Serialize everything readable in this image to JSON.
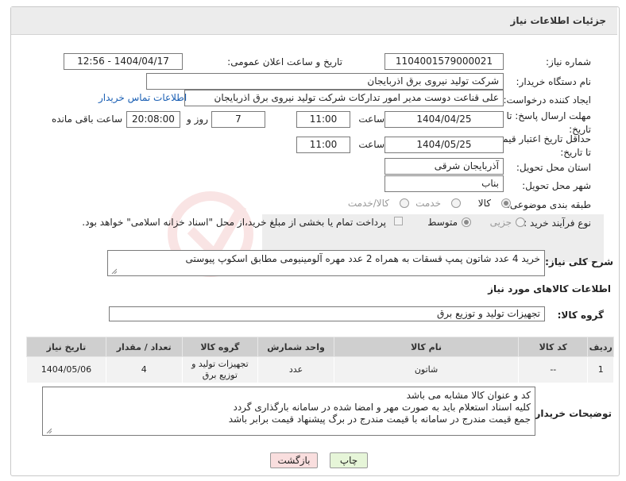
{
  "panel": {
    "title": "جزئیات اطلاعات نیاز"
  },
  "form": {
    "need_number_label": "شماره نیاز:",
    "need_number": "1104001579000021",
    "announce_label": "تاریخ و ساعت اعلان عمومی:",
    "announce_value": "1404/04/17 - 12:56",
    "buyer_org_label": "نام دستگاه خریدار:",
    "buyer_org": "شرکت تولید نیروی برق اذربایجان",
    "requester_label": "ایجاد کننده درخواست:",
    "requester": "علی قناعت دوست مدیر امور تدارکات شرکت تولید نیروی برق اذربایجان",
    "contact_link": "اطلاعات تماس خریدار",
    "reply_deadline_label": "مهلت ارسال پاسخ: تا تاریخ:",
    "reply_date": "1404/04/25",
    "time_label": "ساعت",
    "reply_time": "11:00",
    "days_value": "7",
    "days_label": "روز و",
    "remaining_time": "20:08:00",
    "remaining_label": "ساعت باقی مانده",
    "validity_label": "حداقل تاریخ اعتبار قیمت: تا تاریخ:",
    "validity_date": "1404/05/25",
    "validity_time": "11:00",
    "province_label": "استان محل تحویل:",
    "province": "آذربایجان شرقی",
    "city_label": "شهر محل تحویل:",
    "city": "بناب",
    "category_label": "طبقه بندی موضوعی:",
    "category_options": [
      "کالا",
      "خدمت",
      "کالا/خدمت"
    ],
    "process_label": "نوع فرآیند خرید :",
    "process_options": [
      "جزیی",
      "متوسط"
    ],
    "payment_note": "پرداخت تمام یا بخشی از مبلغ خرید،از محل \"اسناد خزانه اسلامی\" خواهد بود.",
    "summary_label": "شرح کلی نیاز:",
    "summary": "خرید 4 عدد شاتون پمپ قسقات به همراه 2 عدد مهره آلومینیومی مطابق اسکوپ پیوستی"
  },
  "goods": {
    "section_title": "اطلاعات کالاهای مورد نیاز",
    "group_label": "گروه کالا:",
    "group_value": "تجهیزات تولید و توزیع برق",
    "columns": [
      "ردیف",
      "کد کالا",
      "نام کالا",
      "واحد شمارش",
      "گروه کالا",
      "تعداد / مقدار",
      "تاریخ نیاز"
    ],
    "rows": [
      {
        "row": "1",
        "code": "--",
        "name": "شاتون",
        "unit": "عدد",
        "group": "تجهیزات تولید و توزیع برق",
        "qty": "4",
        "date": "1404/05/06"
      }
    ]
  },
  "buyer_notes": {
    "label": "توضیحات خریدار:",
    "lines": [
      "کد و عنوان کالا مشابه می باشد",
      "کلیه اسناد استعلام باید به صورت مهر و امضا شده در سامانه بارگذاری گردد",
      "جمع قیمت مندرج در سامانه با قیمت مندرج در برگ پیشنهاد قیمت برابر باشد"
    ]
  },
  "buttons": {
    "print": "چاپ",
    "back": "بازگشت"
  },
  "colors": {
    "header_bg": "#ececec",
    "link": "#1a5fb4",
    "print_btn": "#e6f5d8",
    "back_btn": "#f9dede"
  }
}
